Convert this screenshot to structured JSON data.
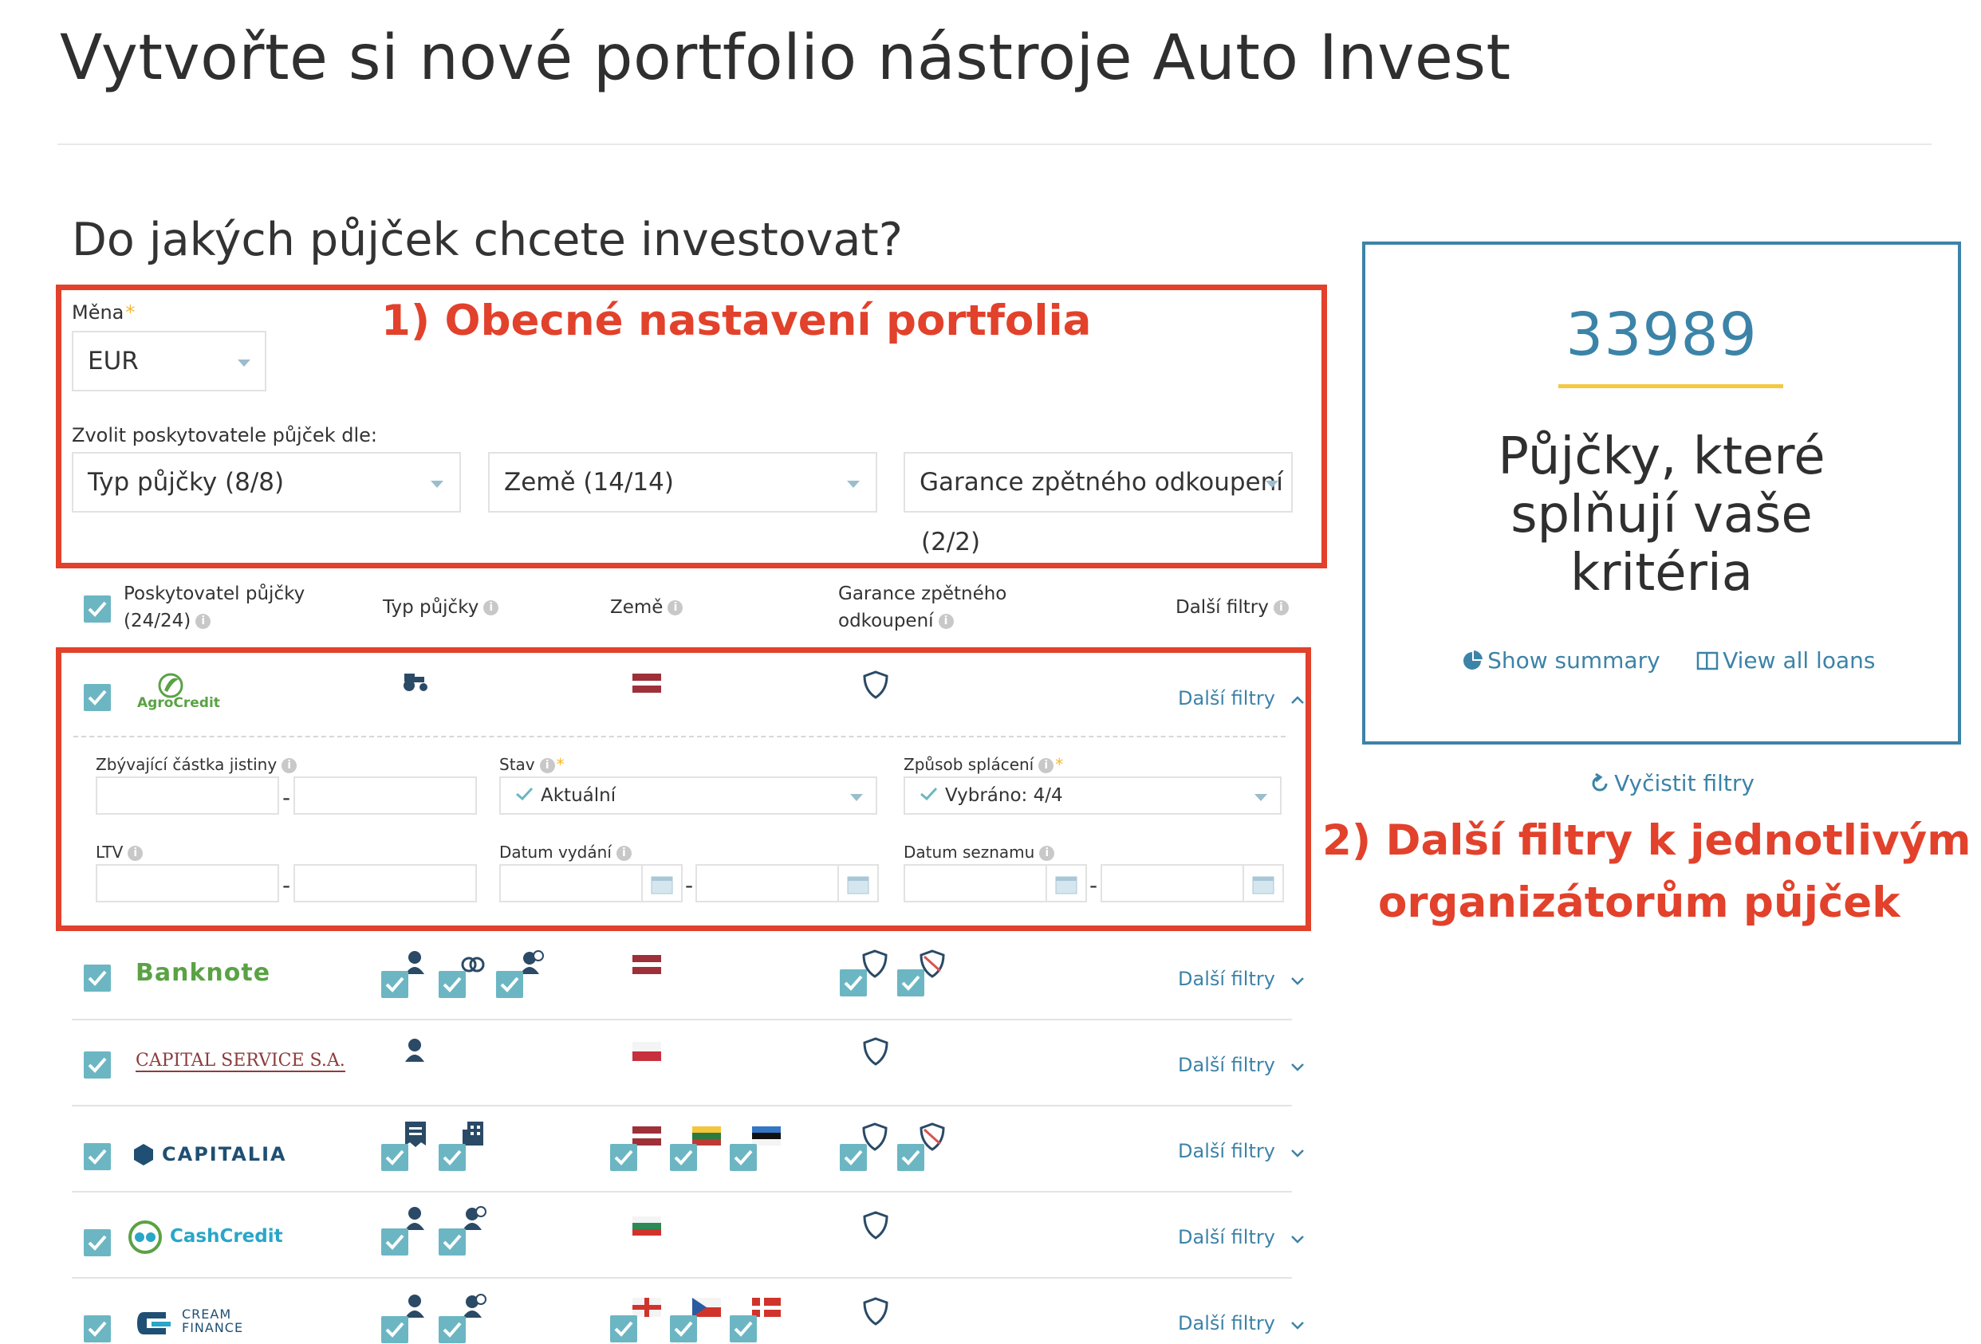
{
  "page_title": "Vytvořte si nové portfolio nástroje Auto Invest",
  "section_title": "Do jakých půjček chcete investovat?",
  "annotations": {
    "general": "1) Obecné nastavení portfolia",
    "filters_line1": "2) Další filtry k jednotlivým",
    "filters_line2": "organizátorům půjček"
  },
  "currency": {
    "label": "Měna",
    "required_mark": "*",
    "value": "EUR"
  },
  "providers_choose_label": "Zvolit poskytovatele půjček dle:",
  "filter_selects": {
    "loan_type": "Typ půjčky (8/8)",
    "country": "Země (14/14)",
    "buyback": "Garance zpětného odkoupení",
    "buyback_count": "(2/2)"
  },
  "table_headers": {
    "provider_line1": "Poskytovatel půjčky",
    "provider_line2": "(24/24)",
    "loan_type": "Typ půjčky",
    "country": "Země",
    "buyback_line1": "Garance zpětného",
    "buyback_line2": "odkoupení",
    "more_filters": "Další filtry",
    "info_glyph": "i"
  },
  "expanded_filters": {
    "remaining_principal_label": "Zbývající částka jistiny",
    "status_label": "Stav",
    "status_value": "Aktuální",
    "repayment_label": "Způsob splácení",
    "repayment_value": "Vybráno: 4/4",
    "ltv_label": "LTV",
    "issue_date_label": "Datum vydání",
    "listing_date_label": "Datum seznamu",
    "range_dash": "-",
    "required_mark": "*"
  },
  "providers": [
    {
      "name": "AgroCredit",
      "logo_color": "#5aa245",
      "more_filters": "Další filtry",
      "expanded": true,
      "loan_type_icons": [
        "tractor-icon"
      ],
      "flags": [
        "latvia"
      ],
      "shields": [
        "shield-icon"
      ]
    },
    {
      "name": "Banknote",
      "logo_color": "#5aa245",
      "more_filters": "Další filtry",
      "expanded": false,
      "loan_type_icons": [
        "person-icon",
        "ring-icon",
        "person-clock-icon"
      ],
      "flags": [
        "latvia"
      ],
      "shields": [
        "shield-icon",
        "shield-crossed-icon"
      ]
    },
    {
      "name": "CAPITAL SERVICE S.A.",
      "logo_color": "#8e3b3b",
      "more_filters": "Další filtry",
      "expanded": false,
      "loan_type_icons": [
        "person-icon"
      ],
      "flags": [
        "poland"
      ],
      "shields": [
        "shield-icon"
      ]
    },
    {
      "name": "CAPITALIA",
      "logo_color": "#1f4f73",
      "more_filters": "Další filtry",
      "expanded": false,
      "loan_type_icons": [
        "invoice-icon",
        "building-icon"
      ],
      "flags": [
        "latvia",
        "lithuania",
        "estonia"
      ],
      "shields": [
        "shield-icon",
        "shield-crossed-icon"
      ]
    },
    {
      "name": "CashCredit",
      "logo_color": "#29a6c8",
      "more_filters": "Další filtry",
      "expanded": false,
      "loan_type_icons": [
        "person-icon",
        "person-clock-icon"
      ],
      "flags": [
        "bulgaria"
      ],
      "shields": [
        "shield-icon"
      ]
    },
    {
      "name": "CREAM FINANCE",
      "name_line1": "CREAM",
      "name_line2": "FINANCE",
      "logo_color": "#1f4f73",
      "more_filters": "Další filtry",
      "expanded": false,
      "loan_type_icons": [
        "person-icon",
        "person-clock-icon"
      ],
      "flags": [
        "georgia",
        "czech",
        "denmark"
      ],
      "shields": [
        "shield-icon"
      ]
    }
  ],
  "summary": {
    "count": "33989",
    "text_line1": "Půjčky, které",
    "text_line2": "splňují vaše",
    "text_line3": "kritéria",
    "show_summary": "Show summary",
    "view_all_loans": "View all loans"
  },
  "clear_filters": "Vyčistit filtry",
  "colors": {
    "accent": "#3c83a8",
    "annotation_red": "#e2412b",
    "checkbox": "#6cb6c3",
    "highlight_yellow": "#f5c842"
  }
}
